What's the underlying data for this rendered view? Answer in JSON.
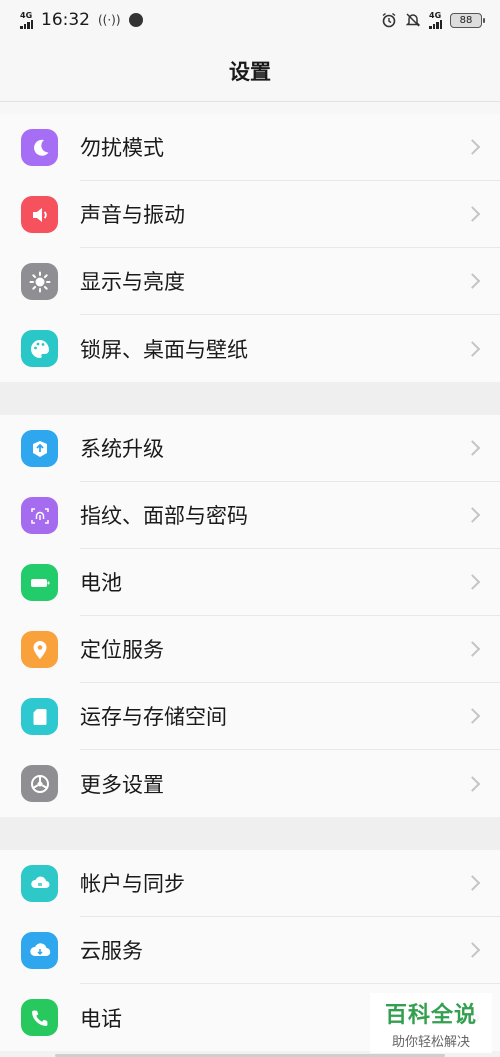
{
  "status_bar": {
    "network_left": "4G",
    "time": "16:32",
    "hotspot": "((·))",
    "network_right": "4G",
    "battery": "88"
  },
  "header": {
    "title": "设置"
  },
  "groups": [
    {
      "items": [
        {
          "label": "勿扰模式",
          "icon": "moon-icon",
          "color": "#a66df5"
        },
        {
          "label": "声音与振动",
          "icon": "speaker-icon",
          "color": "#f5525e"
        },
        {
          "label": "显示与亮度",
          "icon": "sun-icon",
          "color": "#8e8e93"
        },
        {
          "label": "锁屏、桌面与壁纸",
          "icon": "palette-icon",
          "color": "#29c7c8"
        }
      ]
    },
    {
      "items": [
        {
          "label": "系统升级",
          "icon": "upgrade-icon",
          "color": "#2fa7ef"
        },
        {
          "label": "指纹、面部与密码",
          "icon": "fingerprint-icon",
          "color": "#a56cf0"
        },
        {
          "label": "电池",
          "icon": "battery-icon",
          "color": "#22cc6a"
        },
        {
          "label": "定位服务",
          "icon": "location-pin-icon",
          "color": "#f9a23b"
        },
        {
          "label": "运存与存储空间",
          "icon": "sd-card-icon",
          "color": "#2ec8d0"
        },
        {
          "label": "更多设置",
          "icon": "gear-icon",
          "color": "#8e8e93"
        }
      ]
    },
    {
      "items": [
        {
          "label": "帐户与同步",
          "icon": "sync-icon",
          "color": "#2ec8c8"
        },
        {
          "label": "云服务",
          "icon": "cloud-icon",
          "color": "#2fa7ef"
        },
        {
          "label": "电话",
          "icon": "phone-icon",
          "color": "#27c95f"
        }
      ]
    }
  ],
  "watermark": {
    "main": "百科全说",
    "sub": "助你轻松解决"
  }
}
